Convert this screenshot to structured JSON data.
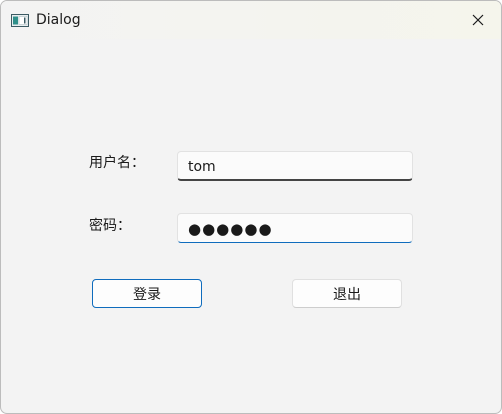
{
  "window": {
    "title": "Dialog",
    "icon": "window-app-icon",
    "close_icon": "close-icon"
  },
  "form": {
    "username_label": "用户名：",
    "username_value": "tom",
    "password_label": "密码：",
    "password_masked": "●●●●●●",
    "password_length": 6
  },
  "buttons": {
    "login_label": "登录",
    "quit_label": "退出"
  },
  "colors": {
    "accent": "#0f6cbd",
    "background": "#f3f3f3"
  }
}
